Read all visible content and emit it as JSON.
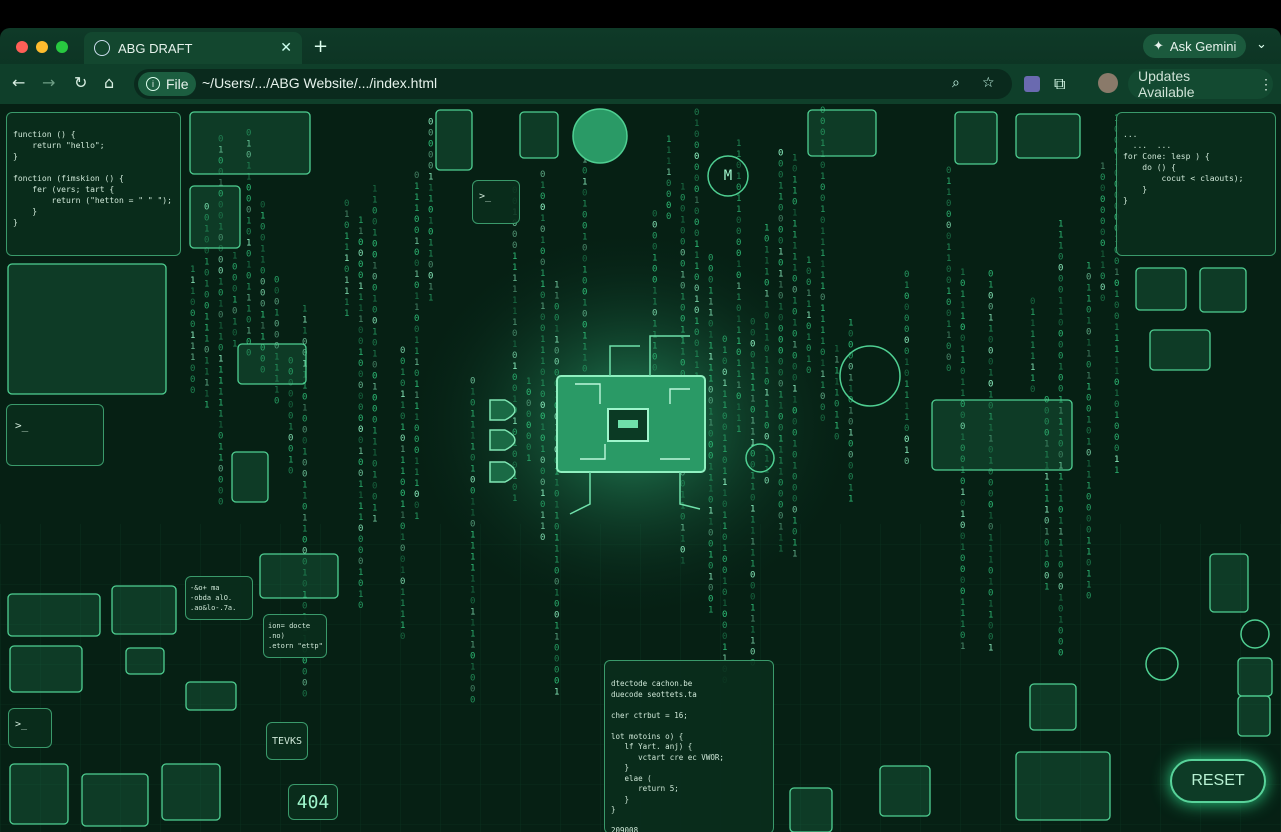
{
  "browser": {
    "tab_title": "ABG DRAFT",
    "new_tab": "+",
    "gemini_label": "Ask Gemini",
    "file_chip": "File",
    "url": "~/Users/.../ABG Website/.../index.html",
    "updates_label": "Updates Available"
  },
  "page": {
    "reset_label": "RESET",
    "code_panel_tl": "function () {\n    return \"hello\";\n}\n\nfonction (fimskion () {\n    fer (vers; tart {\n        return (\"hetton = \" \" \");\n    }\n}",
    "code_panel_tr": "...\n  ...  ...\nfor Cone: lesp ) {\n    do () {\n        cocut < claouts);\n    }\n}",
    "code_panel_bottom": "dtectode cachon.be\nduecode seottets.ta\n\ncher ctrbut = 16;\n\nlot motoins o) {\n   lf Yart. anj) {\n      vctart cre ec VWOR;\n   }\n   elae (\n      return 5;\n   }\n}\n\n209008",
    "code_small_1": "-&o+ ma\n-obda alO.\n.ao&lo-.7a.",
    "code_small_2": "ion= docte\n.no)\n.etorn \"ettp\"",
    "terminal_prompt": ">_",
    "sign_1": "TEVKS",
    "sign_2": "404",
    "chip_label": "M",
    "colors": {
      "bg": "#062014",
      "accent": "#58d39a",
      "glow": "#2ecf85"
    }
  }
}
